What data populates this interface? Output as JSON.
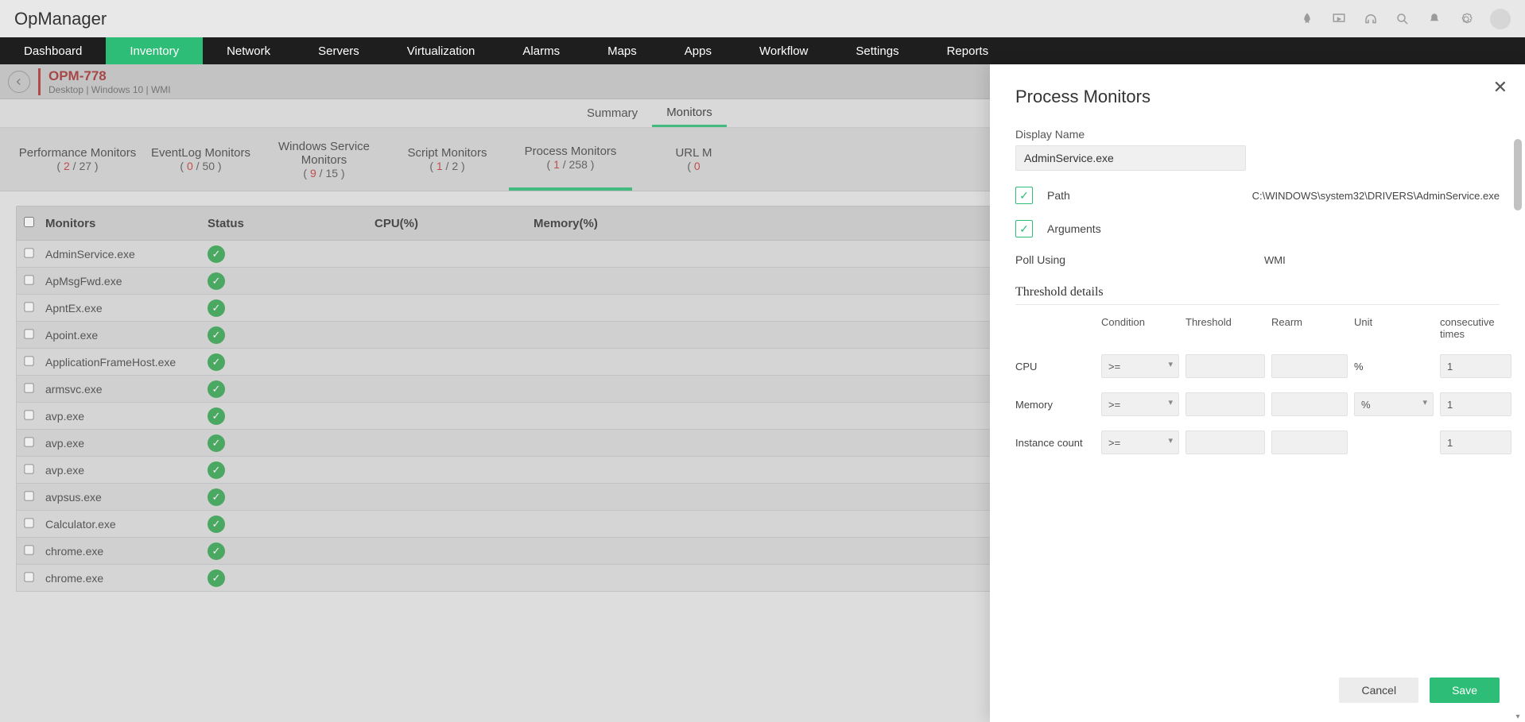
{
  "brand": "OpManager",
  "nav": [
    "Dashboard",
    "Inventory",
    "Network",
    "Servers",
    "Virtualization",
    "Alarms",
    "Maps",
    "Apps",
    "Workflow",
    "Settings",
    "Reports"
  ],
  "nav_active": 1,
  "device": {
    "name": "OPM-778",
    "meta": "Desktop | Windows 10 | WMI"
  },
  "subtabs": [
    "Summary",
    "Monitors"
  ],
  "subtabs_active": 1,
  "montabs": [
    {
      "label": "Performance Monitors",
      "a": "2",
      "b": "27"
    },
    {
      "label": "EventLog Monitors",
      "a": "0",
      "b": "50"
    },
    {
      "label": "Windows Service Monitors",
      "a": "9",
      "b": "15"
    },
    {
      "label": "Script Monitors",
      "a": "1",
      "b": "2"
    },
    {
      "label": "Process Monitors",
      "a": "1",
      "b": "258"
    },
    {
      "label": "URL M",
      "a": "0",
      "b": ""
    }
  ],
  "montabs_active": 4,
  "columns": {
    "monitors": "Monitors",
    "status": "Status",
    "cpu": "CPU(%)",
    "memory": "Memory(%)"
  },
  "rows": [
    {
      "name": "AdminService.exe"
    },
    {
      "name": "ApMsgFwd.exe"
    },
    {
      "name": "ApntEx.exe"
    },
    {
      "name": "Apoint.exe"
    },
    {
      "name": "ApplicationFrameHost.exe"
    },
    {
      "name": "armsvc.exe"
    },
    {
      "name": "avp.exe"
    },
    {
      "name": "avp.exe"
    },
    {
      "name": "avp.exe"
    },
    {
      "name": "avpsus.exe"
    },
    {
      "name": "Calculator.exe"
    },
    {
      "name": "chrome.exe"
    },
    {
      "name": "chrome.exe"
    }
  ],
  "panel": {
    "title": "Process Monitors",
    "display_label": "Display Name",
    "display_value": "AdminService.exe",
    "path_label": "Path",
    "path_value": "C:\\WINDOWS\\system32\\DRIVERS\\AdminService.exe",
    "args_label": "Arguments",
    "poll_label": "Poll Using",
    "poll_value": "WMI",
    "th_title": "Threshold details",
    "th_headers": {
      "cond": "Condition",
      "thr": "Threshold",
      "rearm": "Rearm",
      "unit": "Unit",
      "ct": "consecutive times"
    },
    "th_rows": [
      {
        "name": "CPU",
        "cond": ">=",
        "unit": "%",
        "ct": "1",
        "unit_sel": false
      },
      {
        "name": "Memory",
        "cond": ">=",
        "unit": "%",
        "ct": "1",
        "unit_sel": true
      },
      {
        "name": "Instance count",
        "cond": ">=",
        "unit": "",
        "ct": "1",
        "unit_sel": false
      }
    ],
    "cancel": "Cancel",
    "save": "Save"
  }
}
